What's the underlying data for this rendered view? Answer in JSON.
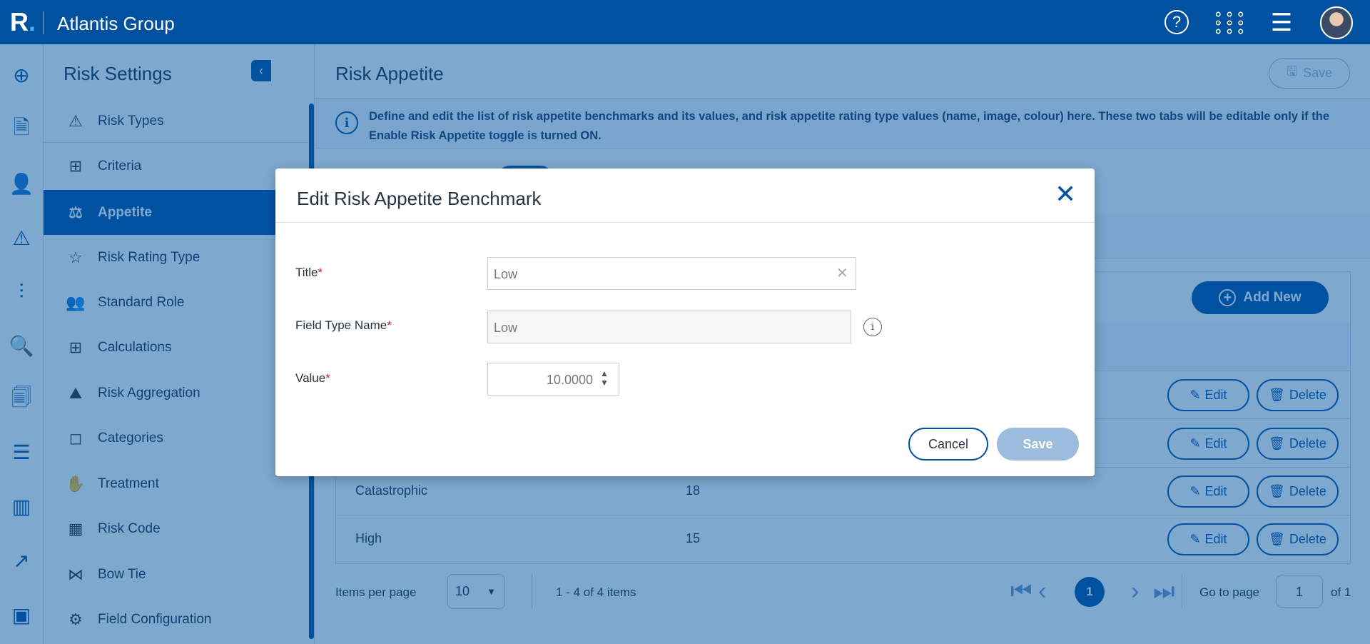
{
  "app": {
    "logo": "R",
    "title": "Atlantis Group",
    "icons": [
      "help-icon",
      "apps-grid-icon",
      "menu-icon",
      "avatar"
    ]
  },
  "rail": {
    "icons": [
      "add-circle-icon",
      "document-export-icon",
      "user-edit-icon",
      "warning-icon",
      "sliders-icon",
      "analytics-icon",
      "report-icon",
      "checklist-icon",
      "bar-chart-icon",
      "trend-chart-icon",
      "dashboard-report-icon"
    ]
  },
  "sidebar": {
    "title": "Risk Settings",
    "items": [
      {
        "label": "Risk Types",
        "icon": "risk-types-icon"
      },
      {
        "label": "Criteria",
        "icon": "criteria-icon"
      },
      {
        "label": "Appetite",
        "icon": "scale-icon",
        "active": true
      },
      {
        "label": "Risk Rating Type",
        "icon": "star-icon"
      },
      {
        "label": "Standard Role",
        "icon": "users-icon"
      },
      {
        "label": "Calculations",
        "icon": "calculator-icon"
      },
      {
        "label": "Risk Aggregation",
        "icon": "aggregation-icon"
      },
      {
        "label": "Categories",
        "icon": "shapes-icon"
      },
      {
        "label": "Treatment",
        "icon": "treatment-icon"
      },
      {
        "label": "Risk Code",
        "icon": "code-icon"
      },
      {
        "label": "Bow Tie",
        "icon": "bow-tie-icon"
      },
      {
        "label": "Field Configuration",
        "icon": "gear-icon"
      }
    ]
  },
  "main": {
    "title": "Risk Appetite",
    "save_label": "Save",
    "info": "Define and edit the list of risk appetite benchmarks and its values, and risk appetite rating type values (name, image, colour) here. These two tabs will be editable only if the Enable Risk Appetite toggle is turned ON.",
    "add_new_label": "Add New",
    "edit_label": "Edit",
    "delete_label": "Delete",
    "rows": [
      {
        "title": "",
        "value": ""
      },
      {
        "title": "",
        "value": ""
      },
      {
        "title": "Catastrophic",
        "value": "18"
      },
      {
        "title": "High",
        "value": "15"
      }
    ],
    "pagination": {
      "items_per_page_label": "Items per page",
      "items_per_page": "10",
      "range": "1 - 4 of 4 items",
      "current_page": "1",
      "go_to_label": "Go to page",
      "go_to_value": "1",
      "of_label": "of 1"
    }
  },
  "modal": {
    "title": "Edit Risk Appetite Benchmark",
    "fields": [
      {
        "label": "Title",
        "value": "Low"
      },
      {
        "label": "Field Type Name",
        "value": "Low"
      },
      {
        "label": "Value",
        "value": "10.0000"
      }
    ],
    "required_mark": "*",
    "cancel_label": "Cancel",
    "save_label": "Save"
  },
  "colors": {
    "primary": "#0052a0",
    "disabled_save": "#9bbcdc",
    "required": "#d0202a"
  }
}
